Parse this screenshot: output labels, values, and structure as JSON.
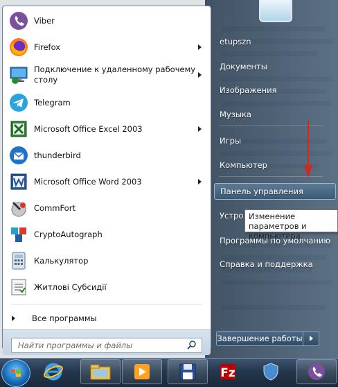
{
  "programs": [
    {
      "label": "Viber",
      "icon": "viber-icon",
      "submenu": false
    },
    {
      "label": "Firefox",
      "icon": "firefox-icon",
      "submenu": true
    },
    {
      "label": "Подключение к удаленному рабочему столу",
      "icon": "remote-desktop-icon",
      "submenu": true
    },
    {
      "label": "Telegram",
      "icon": "telegram-icon",
      "submenu": false
    },
    {
      "label": "Microsoft Office Excel 2003",
      "icon": "excel-icon",
      "submenu": true
    },
    {
      "label": "thunderbird",
      "icon": "thunderbird-icon",
      "submenu": false
    },
    {
      "label": "Microsoft Office Word 2003",
      "icon": "word-icon",
      "submenu": true
    },
    {
      "label": "CommFort",
      "icon": "commfort-icon",
      "submenu": false
    },
    {
      "label": "CryptoAutograph",
      "icon": "cryptoautograph-icon",
      "submenu": false
    },
    {
      "label": "Калькулятор",
      "icon": "calculator-icon",
      "submenu": false
    },
    {
      "label": "Житлові Субсидії",
      "icon": "subsidy-app-icon",
      "submenu": false
    }
  ],
  "all_programs": "Все программы",
  "search": {
    "placeholder": "Найти программы и файлы"
  },
  "right": {
    "items": [
      {
        "label": "etupszn"
      },
      {
        "label": "Документы"
      },
      {
        "label": "Изображения"
      },
      {
        "label": "Музыка"
      },
      {
        "label": "Игры"
      },
      {
        "label": "Компьютер"
      },
      {
        "label": "Панель управления"
      },
      {
        "label": "Устро"
      },
      {
        "label": "Программы по умолчанию"
      },
      {
        "label": "Справка и поддержка"
      }
    ]
  },
  "tooltip": "Изменение параметров и компьютера.",
  "shutdown": "Завершение работы",
  "taskbar": {
    "apps": [
      "internet-explorer-icon",
      "file-explorer-icon",
      "media-player-icon",
      "floppy-save-icon",
      "filezilla-icon",
      "security-shield-icon",
      "viber-icon"
    ]
  },
  "colors": {
    "accent_red": "#d9261c",
    "menu_pane": "#2f4a63"
  }
}
